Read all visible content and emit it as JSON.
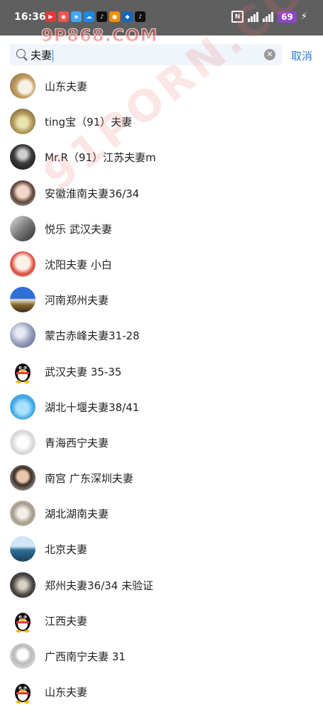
{
  "status": {
    "time": "16:36",
    "battery": "69",
    "app_icons": [
      "video-app-icon",
      "red-app-icon",
      "news-app-icon",
      "cloud-app-icon",
      "tiktok-icon",
      "assistant-app-icon",
      "smart-app-icon",
      "tiktok-icon"
    ],
    "colors": {
      "bar": "#5f5f5f",
      "battery": "#8e44c9"
    }
  },
  "search": {
    "query": "夫妻",
    "cancel_label": "取消"
  },
  "watermark": {
    "top": "9P868.COM",
    "diagonal": "91PORN.COM"
  },
  "contacts": [
    {
      "name": "山东夫妻",
      "avatar": "food-photo-avatar"
    },
    {
      "name": "ting宝（91）夫妻",
      "avatar": "car-photo-avatar"
    },
    {
      "name": "Mr.R（91）江苏夫妻m",
      "avatar": "dark-figure-avatar"
    },
    {
      "name": "安徽淮南夫妻36/34",
      "avatar": "person-photo-avatar"
    },
    {
      "name": "悦乐  武汉夫妻",
      "avatar": "bw-photo-avatar"
    },
    {
      "name": "沈阳夫妻 小白",
      "avatar": "cartoon-avatar"
    },
    {
      "name": "河南郑州夫妻",
      "avatar": "landscape-avatar"
    },
    {
      "name": "蒙古赤峰夫妻31-28",
      "avatar": "texture-avatar"
    },
    {
      "name": "武汉夫妻 35-35",
      "avatar": "qq-penguin-avatar"
    },
    {
      "name": "湖北十堰夫妻38/41",
      "avatar": "blue-bird-avatar"
    },
    {
      "name": "青海西宁夫妻",
      "avatar": "sketch-avatar"
    },
    {
      "name": "南宫  广东深圳夫妻",
      "avatar": "man-portrait-avatar"
    },
    {
      "name": "湖北湖南夫妻",
      "avatar": "cat-photo-avatar"
    },
    {
      "name": "北京夫妻",
      "avatar": "sea-photo-avatar"
    },
    {
      "name": "郑州夫妻36/34  未验证",
      "avatar": "dark-photo-avatar"
    },
    {
      "name": "江西夫妻",
      "avatar": "qq-penguin-avatar"
    },
    {
      "name": "广西南宁夫妻 31",
      "avatar": "drawing-girl-avatar"
    },
    {
      "name": "山东夫妻",
      "avatar": "qq-penguin-avatar"
    }
  ]
}
